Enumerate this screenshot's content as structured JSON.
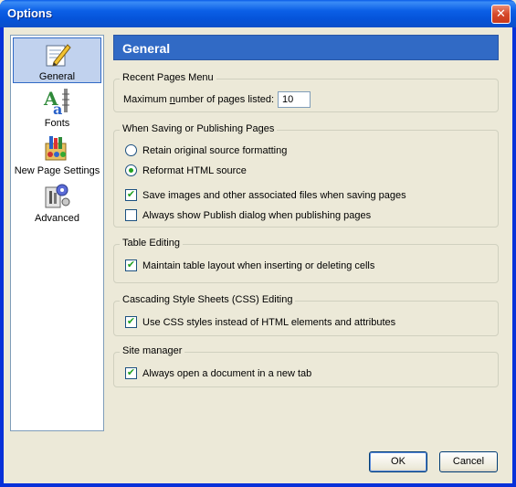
{
  "window": {
    "title": "Options",
    "close_glyph": "✕"
  },
  "sidebar": {
    "items": [
      {
        "label": "General",
        "icon": "general-icon",
        "selected": true
      },
      {
        "label": "Fonts",
        "icon": "fonts-icon",
        "selected": false
      },
      {
        "label": "New Page Settings",
        "icon": "new-page-settings-icon",
        "selected": false
      },
      {
        "label": "Advanced",
        "icon": "advanced-icon",
        "selected": false
      }
    ]
  },
  "panel": {
    "title": "General"
  },
  "recent_pages": {
    "group_title": "Recent Pages Menu",
    "label_prefix": "Maximum ",
    "label_accel": "n",
    "label_suffix": "umber of pages listed:",
    "value": "10"
  },
  "saving": {
    "group_title": "When Saving or Publishing Pages",
    "retain_label": "Retain original source formatting",
    "retain_checked": false,
    "reformat_label": "Reformat HTML source",
    "reformat_checked": true,
    "save_images_label": "Save images and other associated files when saving pages",
    "save_images_checked": true,
    "publish_dialog_label": "Always show Publish dialog when publishing pages",
    "publish_dialog_checked": false
  },
  "table_editing": {
    "group_title": "Table Editing",
    "maintain_label": "Maintain table layout when inserting or deleting cells",
    "maintain_checked": true
  },
  "css_editing": {
    "group_title": "Cascading Style Sheets (CSS) Editing",
    "use_css_label": "Use CSS styles instead of HTML elements and attributes",
    "use_css_checked": true
  },
  "site_manager": {
    "group_title": "Site manager",
    "new_tab_label": "Always open a document in a new tab",
    "new_tab_checked": true
  },
  "buttons": {
    "ok": "OK",
    "cancel": "Cancel"
  },
  "colors": {
    "titlebar": "#0b5fe6",
    "selection": "#c1d2ee",
    "header": "#316ac5",
    "check": "#21a121"
  }
}
